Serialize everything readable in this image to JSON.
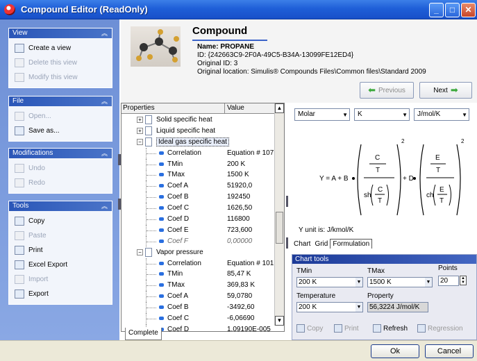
{
  "window": {
    "title": "Compound Editor (ReadOnly)"
  },
  "sidebar": {
    "view": {
      "title": "View",
      "items": [
        {
          "label": "Create a view",
          "icon": "create-view-icon",
          "enabled": true
        },
        {
          "label": "Delete this view",
          "icon": "delete-view-icon",
          "enabled": false
        },
        {
          "label": "Modify this view",
          "icon": "modify-view-icon",
          "enabled": false
        }
      ]
    },
    "file": {
      "title": "File",
      "items": [
        {
          "label": "Open...",
          "icon": "folder-open-icon",
          "enabled": false
        },
        {
          "label": "Save as...",
          "icon": "save-icon",
          "enabled": true
        }
      ]
    },
    "modifications": {
      "title": "Modifications",
      "items": [
        {
          "label": "Undo",
          "icon": "undo-icon",
          "enabled": false
        },
        {
          "label": "Redo",
          "icon": "redo-icon",
          "enabled": false
        }
      ]
    },
    "tools": {
      "title": "Tools",
      "items": [
        {
          "label": "Copy",
          "icon": "copy-icon",
          "enabled": true
        },
        {
          "label": "Paste",
          "icon": "paste-icon",
          "enabled": false
        },
        {
          "label": "Print",
          "icon": "print-icon",
          "enabled": true
        },
        {
          "label": "Excel Export",
          "icon": "excel-icon",
          "enabled": true
        },
        {
          "label": "Import",
          "icon": "import-icon",
          "enabled": false
        },
        {
          "label": "Export",
          "icon": "export-icon",
          "enabled": true
        }
      ]
    }
  },
  "header": {
    "title": "Compound",
    "name": "Name: PROPANE",
    "id": "ID: {242663C9-2F0A-49C5-B34A-13099FE12ED4}",
    "original_id": "Original ID: 3",
    "location": "Original location: Simulis® Compounds Files\\Common files\\Standard 2009",
    "previous_label": "Previous",
    "next_label": "Next"
  },
  "grid": {
    "col_properties": "Properties",
    "col_value": "Value",
    "tab": "Complete",
    "rows": [
      {
        "label": "Solid specific heat",
        "value": "",
        "kind": "group-collapsed"
      },
      {
        "label": "Liquid specific heat",
        "value": "",
        "kind": "group-collapsed"
      },
      {
        "label": "Ideal gas specific heat",
        "value": "",
        "kind": "group-selected"
      },
      {
        "label": "Correlation",
        "value": "Equation # 107",
        "kind": "leaf"
      },
      {
        "label": "TMin",
        "value": "200 K",
        "kind": "leaf"
      },
      {
        "label": "TMax",
        "value": "1500 K",
        "kind": "leaf"
      },
      {
        "label": "Coef A",
        "value": "51920,0",
        "kind": "leaf"
      },
      {
        "label": "Coef B",
        "value": "192450",
        "kind": "leaf"
      },
      {
        "label": "Coef C",
        "value": "1626,50",
        "kind": "leaf"
      },
      {
        "label": "Coef D",
        "value": "116800",
        "kind": "leaf"
      },
      {
        "label": "Coef E",
        "value": "723,600",
        "kind": "leaf"
      },
      {
        "label": "Coef F",
        "value": "0,00000",
        "kind": "leaf-italic"
      },
      {
        "label": "Vapor pressure",
        "value": "",
        "kind": "group-expanded"
      },
      {
        "label": "Correlation",
        "value": "Equation # 101",
        "kind": "leaf"
      },
      {
        "label": "TMin",
        "value": "85,47 K",
        "kind": "leaf"
      },
      {
        "label": "TMax",
        "value": "369,83 K",
        "kind": "leaf"
      },
      {
        "label": "Coef A",
        "value": "59,0780",
        "kind": "leaf"
      },
      {
        "label": "Coef B",
        "value": "-3492,60",
        "kind": "leaf"
      },
      {
        "label": "Coef C",
        "value": "-6,06690",
        "kind": "leaf"
      },
      {
        "label": "Coef D",
        "value": "1,09190E-005",
        "kind": "leaf"
      }
    ]
  },
  "units": {
    "basis": "Molar",
    "temperature": "K",
    "property": "J/mol/K"
  },
  "formula": {
    "lhs": "Y = A + B",
    "plus_d": "+ D",
    "C": "C",
    "T": "T",
    "E": "E",
    "sh": "sh",
    "ch": "ch",
    "exp": "2"
  },
  "y_unit": "Y unit is: J/kmol/K",
  "panel_tabs": [
    "Chart",
    "Grid",
    "Formulation"
  ],
  "chart_tools": {
    "title": "Chart tools",
    "tmin_label": "TMin",
    "tmin_value": "200 K",
    "tmax_label": "TMax",
    "tmax_value": "1500 K",
    "points_label": "Points",
    "points_value": "20",
    "temperature_label": "Temperature",
    "temperature_value": "200 K",
    "property_label": "Property",
    "property_value": "56,3224 J/mol/K",
    "copy": "Copy",
    "print": "Print",
    "refresh": "Refresh",
    "regression": "Regression"
  },
  "footer": {
    "ok": "Ok",
    "cancel": "Cancel"
  },
  "colors": {
    "titlebar": "#2a66db",
    "taskpane": "#7b9be0",
    "group_header": "#2a56b8",
    "accent_green": "#3aa83a"
  }
}
